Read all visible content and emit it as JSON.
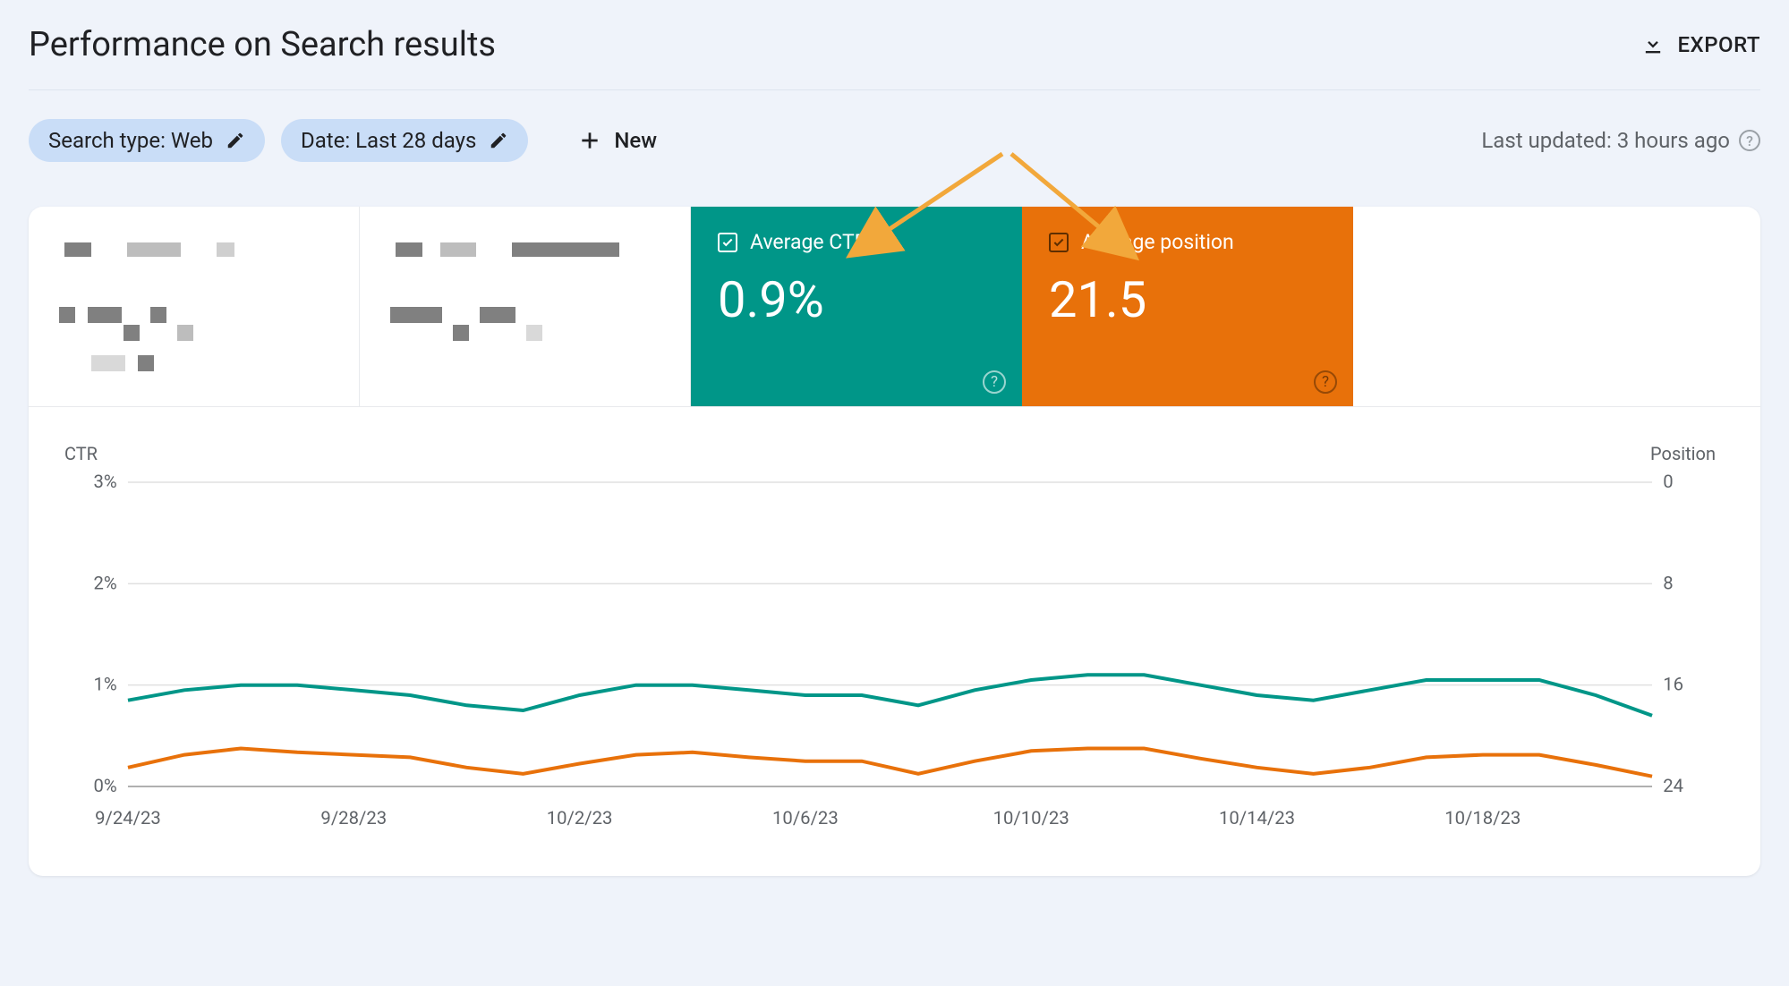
{
  "header": {
    "title": "Performance on Search results",
    "export_label": "EXPORT"
  },
  "filters": {
    "search_type": "Search type: Web",
    "date_range": "Date: Last 28 days",
    "new_label": "New",
    "last_updated": "Last updated: 3 hours ago"
  },
  "cards": {
    "ctr_label": "Average CTR",
    "ctr_value": "0.9%",
    "position_label": "Average position",
    "position_value": "21.5"
  },
  "chart_labels": {
    "left_axis": "CTR",
    "right_axis": "Position"
  },
  "chart_data": {
    "type": "line",
    "title": "Performance on Search results",
    "xlabel": "",
    "ylabel_left": "CTR",
    "ylabel_right": "Position",
    "ylim_left": [
      0,
      3
    ],
    "ylim_right": [
      24,
      0
    ],
    "y_ticks_left": [
      "0%",
      "1%",
      "2%",
      "3%"
    ],
    "y_ticks_right": [
      24,
      16,
      8,
      0
    ],
    "x_ticks": [
      "9/24/23",
      "9/28/23",
      "10/2/23",
      "10/6/23",
      "10/10/23",
      "10/14/23",
      "10/18/23"
    ],
    "categories": [
      "9/24/23",
      "9/25/23",
      "9/26/23",
      "9/27/23",
      "9/28/23",
      "9/29/23",
      "9/30/23",
      "10/1/23",
      "10/2/23",
      "10/3/23",
      "10/4/23",
      "10/5/23",
      "10/6/23",
      "10/7/23",
      "10/8/23",
      "10/9/23",
      "10/10/23",
      "10/11/23",
      "10/12/23",
      "10/13/23",
      "10/14/23",
      "10/15/23",
      "10/16/23",
      "10/17/23",
      "10/18/23",
      "10/19/23",
      "10/20/23",
      "10/21/23"
    ],
    "series": [
      {
        "name": "Average CTR",
        "axis": "left",
        "color": "#009688",
        "values": [
          0.85,
          0.95,
          1.0,
          1.0,
          0.95,
          0.9,
          0.8,
          0.75,
          0.9,
          1.0,
          1.0,
          0.95,
          0.9,
          0.9,
          0.8,
          0.95,
          1.05,
          1.1,
          1.1,
          1.0,
          0.9,
          0.85,
          0.95,
          1.05,
          1.05,
          1.05,
          0.9,
          0.7
        ]
      },
      {
        "name": "Average position",
        "axis": "right",
        "color": "#e8710a",
        "values": [
          22.5,
          21.5,
          21.0,
          21.3,
          21.5,
          21.7,
          22.5,
          23.0,
          22.2,
          21.5,
          21.3,
          21.7,
          22.0,
          22.0,
          23.0,
          22.0,
          21.2,
          21.0,
          21.0,
          21.8,
          22.5,
          23.0,
          22.5,
          21.7,
          21.5,
          21.5,
          22.3,
          23.2
        ]
      }
    ]
  }
}
